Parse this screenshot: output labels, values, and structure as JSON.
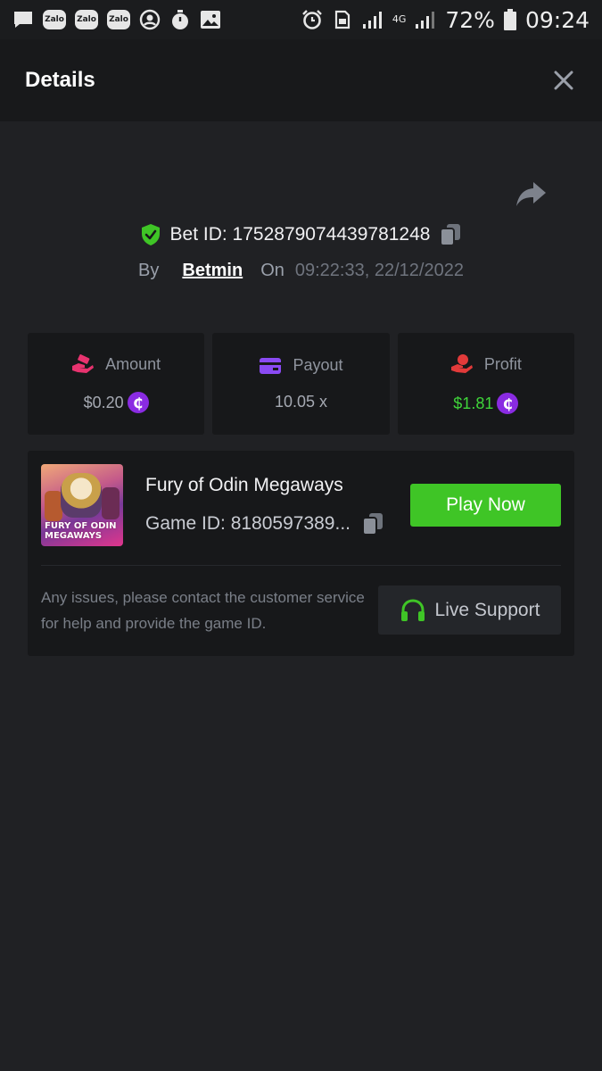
{
  "status_bar": {
    "zalo_label": "Zalo",
    "battery": "72%",
    "time": "09:24",
    "network": "4G"
  },
  "header": {
    "title": "Details"
  },
  "bet": {
    "id_label": "Bet ID: 1752879074439781248",
    "by_label": "By",
    "user": "Betmin",
    "on_label": "On",
    "datetime": "09:22:33, 22/12/2022"
  },
  "stats": [
    {
      "label": "Amount",
      "value": "$0.20",
      "icon": "hand-coins-icon",
      "icon_color": "#e8336f",
      "coin": true
    },
    {
      "label": "Payout",
      "value": "10.05 x",
      "icon": "card-icon",
      "icon_color": "#8a4af3",
      "coin": false
    },
    {
      "label": "Profit",
      "value": "$1.81",
      "icon": "hand-dollar-icon",
      "icon_color": "#e23a3a",
      "coin": true,
      "value_color": "#3fd43a"
    }
  ],
  "coin_symbol": "₵",
  "game": {
    "thumb_logo_line1": "FURY OF ODIN",
    "thumb_logo_line2": "MEGAWAYS",
    "name": "Fury of Odin Megaways",
    "id_label": "Game ID: 8180597389...",
    "play_label": "Play Now",
    "support_text": "Any issues, please contact the customer service for help and provide the game ID.",
    "support_label": "Live Support"
  },
  "colors": {
    "background": "#202124",
    "card": "#17181a",
    "accent_green": "#3fc526",
    "coin_purple": "#8a2be2"
  }
}
